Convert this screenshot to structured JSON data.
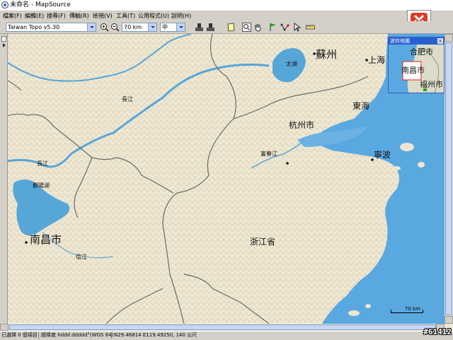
{
  "window": {
    "title": "未命名 - MapSource"
  },
  "menu": [
    {
      "label": "檔案(F)"
    },
    {
      "label": "編輯(E)"
    },
    {
      "label": "搜尋(F)"
    },
    {
      "label": "傳輸(R)"
    },
    {
      "label": "檢視(V)"
    },
    {
      "label": "工具(T)"
    },
    {
      "label": "公用程式(U)"
    },
    {
      "label": "說明(H)"
    }
  ],
  "toolbar": {
    "map_product": "Taiwan Topo v5.30",
    "zoom_level": "70 km",
    "detail_level": "中",
    "icons": [
      "zoom-in-icon",
      "zoom-out-icon",
      "receive-from-device-icon",
      "send-to-device-icon",
      "select-map-icon",
      "zoom-tool-icon",
      "hand-tool-icon",
      "waypoint-tool-icon",
      "route-tool-icon",
      "selection-tool-icon",
      "measure-tool-icon"
    ]
  },
  "map": {
    "labels": {
      "suzhou": "蘇州",
      "taihu": "太湖",
      "shanghai": "上海",
      "changjiang": "長江",
      "donghai": "東海",
      "hangzhou": "杭州市",
      "fuchunjiang": "富春江",
      "ningbo": "寧波",
      "changjiang2": "長江",
      "poyanghu": "鄱陽湖",
      "nanchang": "南昌市",
      "xinjiang": "信江",
      "zhejiang": "浙江省"
    },
    "scale": "70 km",
    "colors": {
      "land": "#efe9d6",
      "water": "#5aa8e0",
      "lake": "#56a6d8",
      "border": "#6a6a6a"
    }
  },
  "overview": {
    "title": "迷你地圖",
    "close": "x",
    "labels": {
      "hefei": "合肥市",
      "nanchang": "南昌市",
      "fuzhou": "福州市"
    }
  },
  "status": {
    "selection": "已選擇 0 個項目",
    "coord_format": "經緯度 hddd.ddddd°(WGS 84)",
    "position": "N29.46814 E119.49250, 140 公尺"
  },
  "watermark": "#61412"
}
